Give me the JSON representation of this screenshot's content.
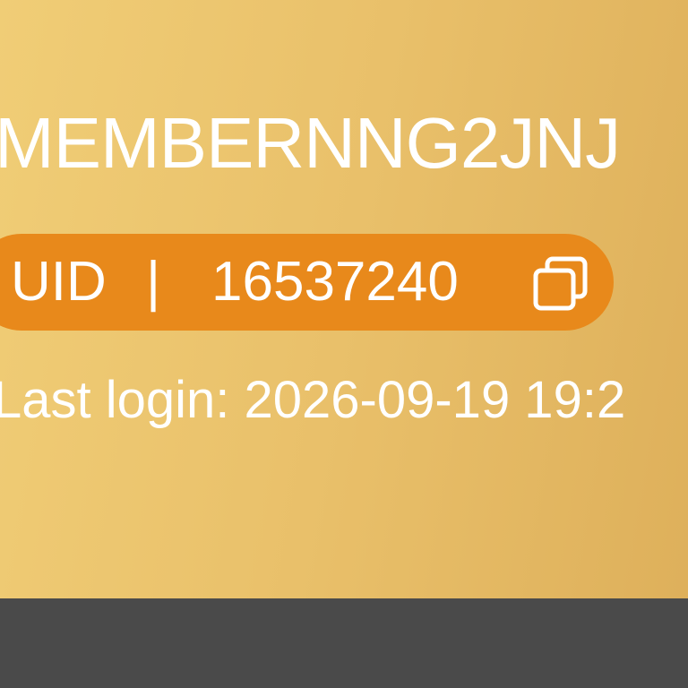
{
  "profile": {
    "username": "MEMBERNNG2JNJ",
    "uid_label": "UID",
    "uid_separator": "|",
    "uid_value": "16537240",
    "copy_icon": "copy-icon",
    "last_login": "Last login: 2026-09-19 19:2"
  },
  "colors": {
    "card_gradient_start": "#f0cd76",
    "card_gradient_end": "#deb05b",
    "uid_pill": "#e8891b",
    "text": "#ffffff",
    "bottom_bar": "#4a4a4a"
  }
}
